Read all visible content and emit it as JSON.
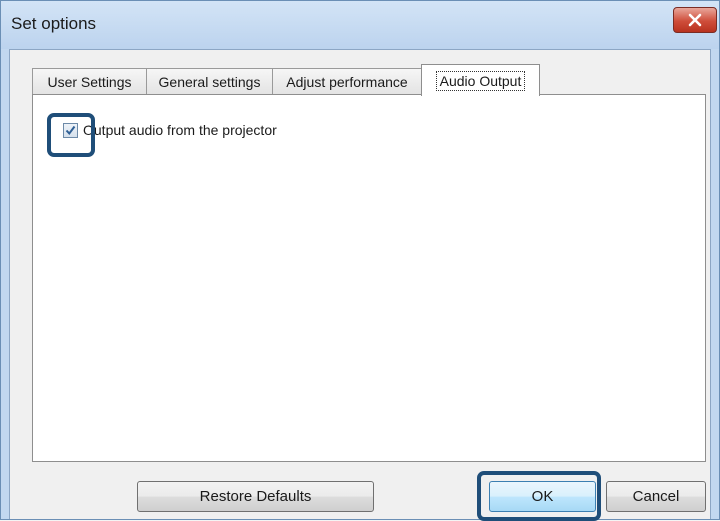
{
  "window": {
    "title": "Set options",
    "close_icon": "close-icon"
  },
  "tabs": [
    {
      "label": "User Settings",
      "active": false
    },
    {
      "label": "General settings",
      "active": false
    },
    {
      "label": "Adjust performance",
      "active": false
    },
    {
      "label": "Audio Output",
      "active": true
    }
  ],
  "audio_output": {
    "checkbox_label": "Output audio from the projector",
    "checked": true
  },
  "buttons": {
    "restore_defaults": "Restore Defaults",
    "ok": "OK",
    "cancel": "Cancel"
  },
  "colors": {
    "highlight": "#1f4e79",
    "title_bar": "#c2d8f0",
    "close_button": "#cf4d3a"
  }
}
